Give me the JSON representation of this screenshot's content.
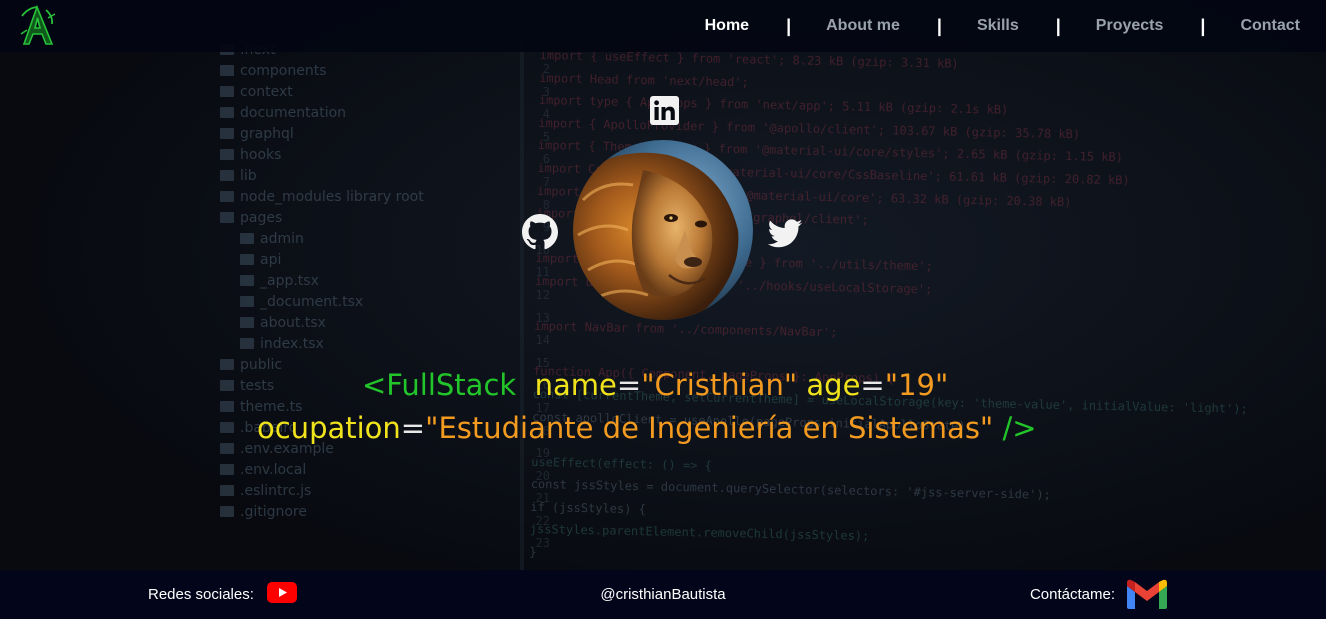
{
  "navbar": {
    "logo_icon": "stylized-a-logo-icon",
    "items": [
      {
        "label": "Home",
        "active": true
      },
      {
        "label": "About me",
        "active": false
      },
      {
        "label": "Skills",
        "active": false
      },
      {
        "label": "Proyects",
        "active": false
      },
      {
        "label": "Contact",
        "active": false
      }
    ],
    "separator": "|"
  },
  "profile": {
    "avatar_icon": "lion-avatar",
    "social": [
      "linkedin-icon",
      "github-icon",
      "twitter-icon"
    ]
  },
  "tagline": {
    "open": "<FullStack",
    "attr1_name": "name",
    "attr1_eq": "=",
    "attr1_value": "\"Cristhian\"",
    "attr2_name": "age",
    "attr2_eq": "=",
    "attr2_value": "\"19\"",
    "attr3_name": "ocupation",
    "attr3_eq": "=",
    "attr3_value": "\"Estudiante de Ingeniería en Sistemas\"",
    "close": "/>"
  },
  "footer": {
    "social_label": "Redes sociales:",
    "social_icon": "youtube-icon",
    "handle": "@cristhianBautista",
    "contact_label": "Contáctame:",
    "contact_icon": "gmail-icon"
  },
  "colors": {
    "tag_green": "#22c52a",
    "attr_yellow": "#f0e31c",
    "value_orange": "#f39a20",
    "nav_bg": "#03061a"
  },
  "background_code": {
    "tree": [
      ".next",
      "components",
      "context",
      "documentation",
      "graphql",
      "hooks",
      "lib",
      "node_modules  library root",
      "pages",
      "admin",
      "api",
      "_app.tsx",
      "_document.tsx",
      "about.tsx",
      "index.tsx",
      "public",
      "tests",
      "theme.ts",
      ".babelrc",
      ".env.example",
      ".env.local",
      ".eslintrc.js",
      ".gitignore"
    ],
    "gutter": [
      "2",
      "3",
      "4",
      "5",
      "6",
      "7",
      "8",
      "9",
      "10",
      "11",
      "12",
      "13",
      "14",
      "15",
      "16",
      "17",
      "18",
      "19",
      "20",
      "21",
      "22",
      "23"
    ],
    "lines": [
      "import { useEffect } from 'react';  8.23 kB (gzip: 3.31 kB)",
      "import Head from 'next/head';",
      "import type { AppProps } from 'next/app';  5.11 kB (gzip: 2.1s kB)",
      "import { ApolloProvider } from '@apollo/client';  103.67 kB (gzip: 35.78 kB)",
      "import { ThemeProvider } from '@material-ui/core/styles';  2.65 kB (gzip: 1.15 kB)",
      "import CssBaseline from '@material-ui/core/CssBaseline';  61.61 kB (gzip: 20.82 kB)",
      "import { createTheme } from '@material-ui/core';  63.32 kB (gzip: 20.38 kB)",
      "import { useApollo } from '../graphql/client';",
      "",
      "import { lightTheme, darkTheme } from '../utils/theme';",
      "import useLocalStorage from '../hooks/useLocalStorage';",
      "",
      "import NavBar from '../components/NavBar';",
      "",
      "function App({ Component, pageProps }: AppProps) {",
      "  const [currentTheme, setCurrentTheme] = useLocalStorage(key: 'theme-value', initialValue: 'light');",
      "  const apolloClient = useApollo(pageProps.initialApolloState);",
      "",
      "  useEffect(effect: () => {",
      "    const jssStyles = document.querySelector(selectors: '#jss-server-side');",
      "    if (jssStyles) {",
      "      jssStyles.parentElement.removeChild(jssStyles);",
      "    }",
      "  }, []);"
    ]
  }
}
